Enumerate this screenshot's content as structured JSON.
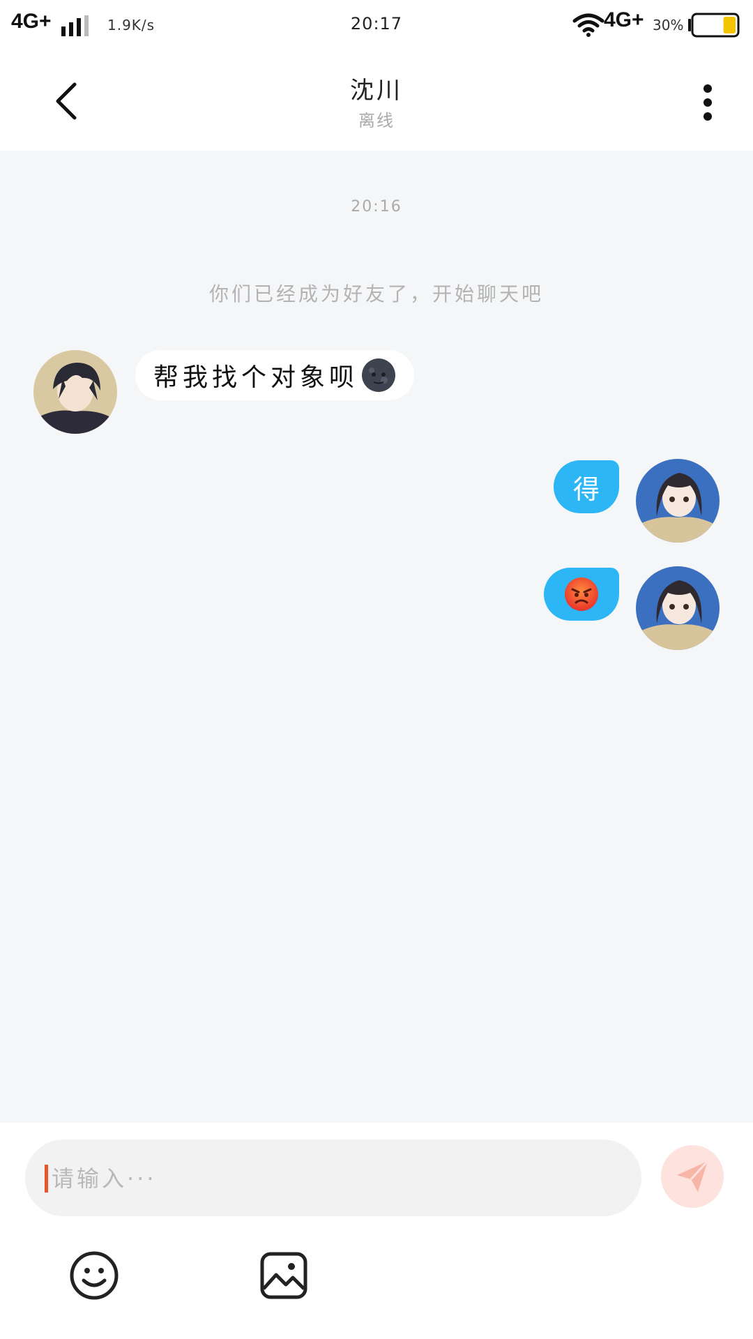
{
  "status_bar": {
    "network_left": "4G+",
    "speed": "1.9K/s",
    "time": "20:17",
    "network_right": "4G+",
    "battery_percent": "30%",
    "battery_level": 0.3,
    "icons": [
      "signal-icon",
      "wifi-icon",
      "battery-icon"
    ]
  },
  "header": {
    "contact_name": "沈川",
    "contact_status": "离线",
    "icons": [
      "back-arrow-icon",
      "more-vertical-icon"
    ]
  },
  "chat": {
    "timestamp": "20:16",
    "system_notice": "你们已经成为好友了，开始聊天吧",
    "messages": [
      {
        "side": "incoming",
        "text": "帮我找个对象呗",
        "emoji": "new-moon-face-emoji"
      },
      {
        "side": "outgoing",
        "text": "得"
      },
      {
        "side": "outgoing",
        "text": "",
        "emoji": "angry-face-emoji"
      }
    ]
  },
  "input": {
    "placeholder": "请输入···",
    "value": "",
    "icons": [
      "send-icon",
      "emoji-icon",
      "image-icon"
    ]
  },
  "colors": {
    "chat_background": "#f4f6f8",
    "outgoing_bubble": "#2cb6f6",
    "incoming_bubble": "#ffffff",
    "send_button": "#fde2dd",
    "caret": "#e8552a"
  }
}
